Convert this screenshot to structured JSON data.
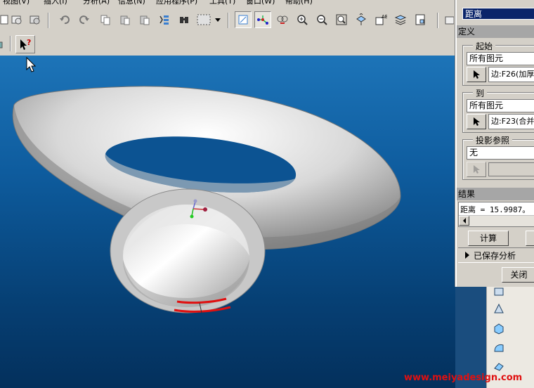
{
  "menu": {
    "items": [
      "视图(V)",
      "插入(I)",
      "分析(A)",
      "信息(N)",
      "应用程序(P)",
      "工具(T)",
      "窗口(W)",
      "帮助(H)"
    ]
  },
  "toolbar": {
    "icons": [
      "new-file-icon",
      "open-file-icon",
      "save-icon",
      "print-icon",
      "undo-icon",
      "redo-icon",
      "copy-icon",
      "paste-icon",
      "paste-special-icon",
      "regenerate-icon",
      "find-icon",
      "select-box-icon",
      "repaint-icon",
      "spin-center-icon",
      "orient-icon",
      "zoom-in-icon",
      "zoom-out-icon",
      "refit-icon",
      "reorient-icon",
      "saved-views-icon",
      "layers-icon",
      "model-tree-icon"
    ]
  },
  "toolbar2": {
    "context_help_icon": "whats-this-help-icon"
  },
  "dialog": {
    "type_value": "距离",
    "definition_label": "定义",
    "from": {
      "title": "起始",
      "value": "所有图元",
      "pick_value": "边:F26(加厚"
    },
    "to": {
      "title": "到",
      "value": "所有图元",
      "pick_value": "边:F23(合并"
    },
    "projection": {
      "title": "投影参照",
      "value": "无",
      "pick_value": ""
    },
    "results_label": "结果",
    "result_text": "距离 = 15.9987。",
    "compute_label": "计算",
    "saved_analysis_label": "已保存分析",
    "close_label": "关闭"
  },
  "watermark": "www.meiyadesign.com",
  "colors": {
    "viewport_top": "#1d74b8",
    "viewport_bottom": "#04305c",
    "selection": "#0a246a",
    "highlight_edge": "#e01010"
  }
}
